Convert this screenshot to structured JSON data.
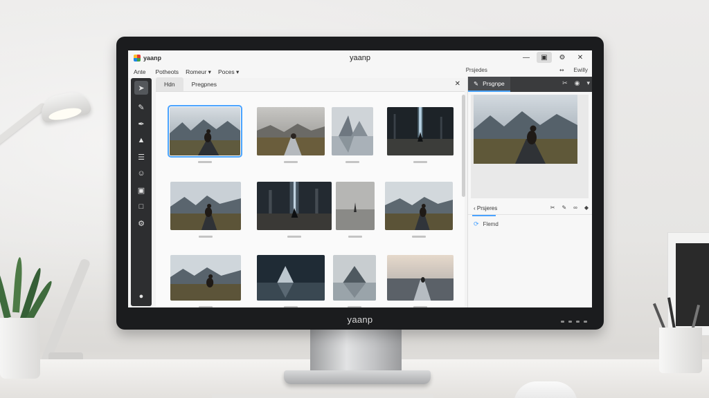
{
  "app": {
    "logo_text": "yaanp",
    "window_title": "yaanp",
    "monitor_brand": "yaanp"
  },
  "menubar": {
    "items": [
      "Ante",
      "Potheots",
      "Romeur",
      "Poces"
    ],
    "right": [
      "Prsjedes",
      "Ewilly"
    ]
  },
  "tabs": [
    "Hdn",
    "Pregpnes"
  ],
  "right_panel": {
    "tab_label": "Prsgnpe",
    "section_label": "Prsjeres",
    "file_label": "Flemd"
  },
  "icons": {
    "window_controls": [
      "minimize-icon",
      "maximize-icon",
      "settings-icon",
      "close-icon"
    ],
    "sidebar": [
      "select-icon",
      "brush-icon",
      "pen-icon",
      "stamp-icon",
      "layers-icon",
      "person-icon",
      "folder-icon",
      "document-icon",
      "settings-icon",
      "help-icon"
    ],
    "section_tools": [
      "crop-icon",
      "edit-icon",
      "link-icon",
      "tag-icon"
    ]
  },
  "colors": {
    "accent": "#4aa3ff",
    "sidebar": "#2d2e30",
    "panel_header": "#3a3b3d",
    "bezel": "#1b1c1e"
  }
}
